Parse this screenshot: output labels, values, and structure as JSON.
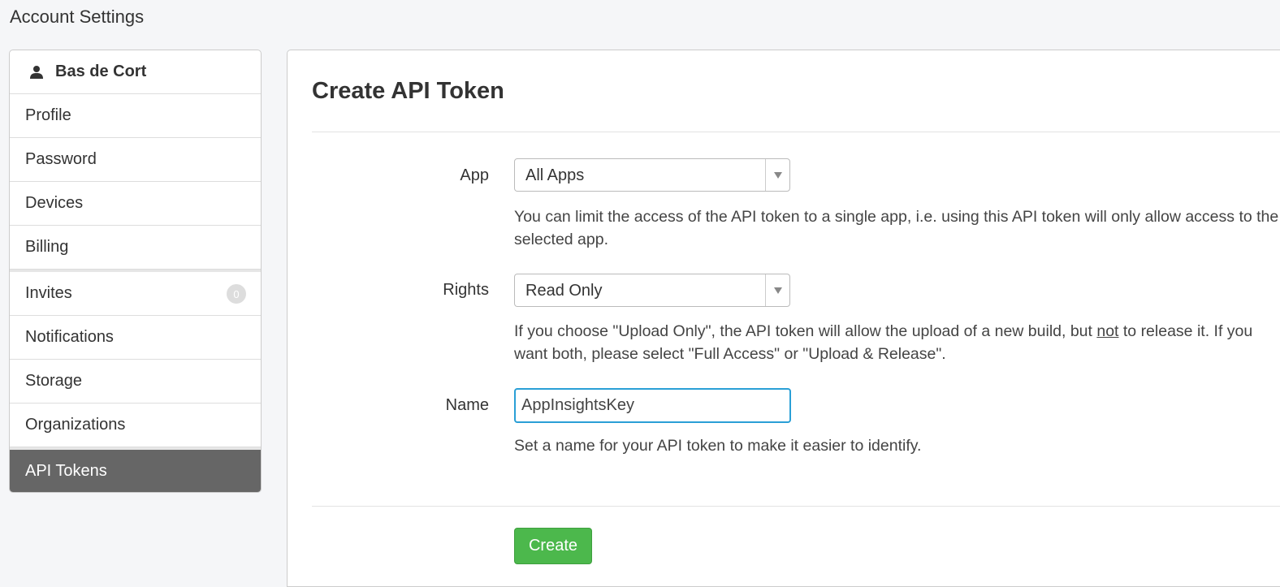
{
  "page": {
    "title": "Account Settings"
  },
  "sidebar": {
    "user_name": "Bas de Cort",
    "items": [
      {
        "label": "Profile"
      },
      {
        "label": "Password"
      },
      {
        "label": "Devices"
      },
      {
        "label": "Billing"
      },
      {
        "label": "Invites",
        "badge": "0"
      },
      {
        "label": "Notifications"
      },
      {
        "label": "Storage"
      },
      {
        "label": "Organizations"
      },
      {
        "label": "API Tokens",
        "active": true
      }
    ]
  },
  "form": {
    "title": "Create API Token",
    "app": {
      "label": "App",
      "selected": "All Apps",
      "help": "You can limit the access of the API token to a single app, i.e. using this API token will only allow access to the selected app."
    },
    "rights": {
      "label": "Rights",
      "selected": "Read Only",
      "help_before": "If you choose \"Upload Only\", the API token will allow the upload of a new build, but ",
      "help_emphasis": "not",
      "help_after": " to release it. If you want both, please select \"Full Access\" or \"Upload & Release\"."
    },
    "name": {
      "label": "Name",
      "value": "AppInsightsKey",
      "help": "Set a name for your API token to make it easier to identify."
    },
    "submit_label": "Create"
  },
  "colors": {
    "accent_blue": "#2a9fd6",
    "create_green": "#4cb84c",
    "active_item": "#666666"
  }
}
